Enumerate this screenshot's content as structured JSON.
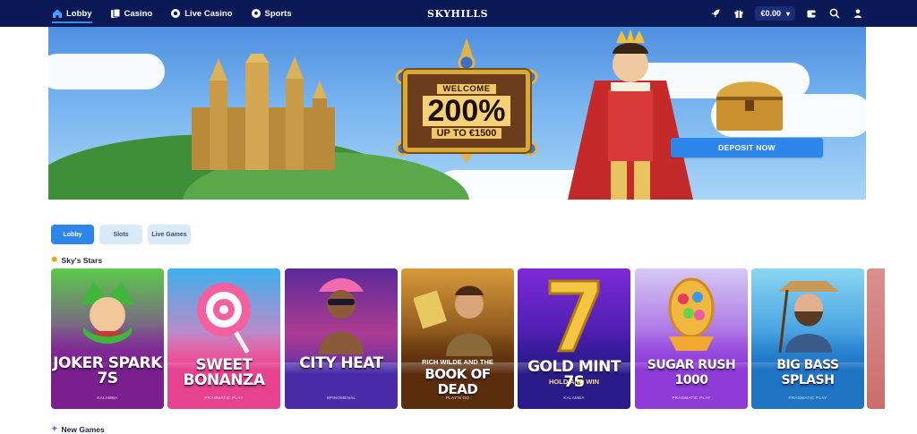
{
  "nav": {
    "items": [
      {
        "label": "Lobby",
        "icon": "home-icon",
        "active": true
      },
      {
        "label": "Casino",
        "icon": "cards-icon",
        "active": false
      },
      {
        "label": "Live Casino",
        "icon": "live-icon",
        "active": false
      },
      {
        "label": "Sports",
        "icon": "soccer-ball-icon",
        "active": false
      }
    ],
    "logo": "SKYHILLS"
  },
  "header_tools": {
    "rocket": "rocket-icon",
    "gift": "gift-icon",
    "balance": "€0.00",
    "wallet": "wallet-icon",
    "search": "search-icon",
    "user": "user-icon"
  },
  "banner": {
    "welcome": "WELCOME",
    "percent": "200%",
    "upto": "UP TO €1500",
    "cta": "DEPOSIT NOW"
  },
  "tabs": [
    "Lobby",
    "Slots",
    "Live Games"
  ],
  "sections": {
    "stars": "Sky's Stars",
    "new": "New Games"
  },
  "games": [
    {
      "title": "JOKER SPARK 7S",
      "provider": "KALAMBA",
      "sub": "",
      "colors": [
        "#6ad24f",
        "#7b1f8e"
      ]
    },
    {
      "title": "SWEET BONANZA",
      "provider": "PRAGMATIC PLAY",
      "sub": "",
      "colors": [
        "#45b7f0",
        "#ef4f9a"
      ]
    },
    {
      "title": "CITY HEAT",
      "provider": "SPINOMENAL",
      "sub": "",
      "colors": [
        "#6b2aa0",
        "#e0348c"
      ]
    },
    {
      "title": "BOOK OF DEAD",
      "provider": "PLAY'N GO",
      "sub": "RICH WILDE AND THE",
      "colors": [
        "#c9842a",
        "#5a2e0c"
      ]
    },
    {
      "title": "GOLD MINT 7S",
      "provider": "KALAMBA",
      "sub": "HOLD AND WIN",
      "colors": [
        "#7a2ad0",
        "#2a1a8a"
      ]
    },
    {
      "title": "SUGAR RUSH 1000",
      "provider": "PRAGMATIC PLAY",
      "sub": "",
      "colors": [
        "#c8b7f0",
        "#8e3bd8"
      ]
    },
    {
      "title": "BIG BASS SPLASH",
      "provider": "PRAGMATIC PLAY",
      "sub": "",
      "colors": [
        "#4fb7e8",
        "#1f74c4"
      ]
    }
  ]
}
